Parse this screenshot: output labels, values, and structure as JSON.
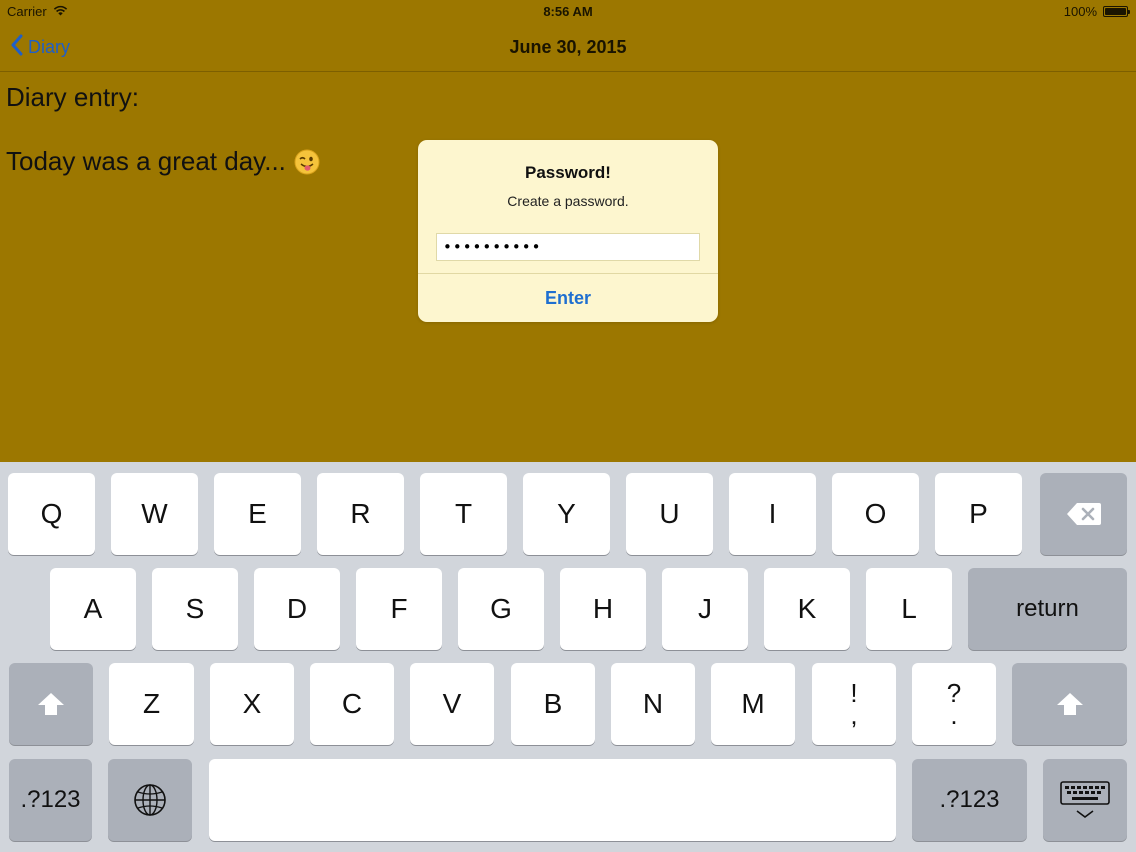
{
  "status_bar": {
    "carrier": "Carrier",
    "time": "8:56 AM",
    "battery": "100%"
  },
  "nav": {
    "back_label": "Diary",
    "title": "June 30, 2015"
  },
  "content": {
    "label": "Diary entry:",
    "text": "Today was a great day..."
  },
  "alert": {
    "title": "Password!",
    "message": "Create a password.",
    "input_value": "••••••••••",
    "button_label": "Enter"
  },
  "keyboard": {
    "row1": [
      "Q",
      "W",
      "E",
      "R",
      "T",
      "Y",
      "U",
      "I",
      "O",
      "P"
    ],
    "row2": [
      "A",
      "S",
      "D",
      "F",
      "G",
      "H",
      "J",
      "K",
      "L"
    ],
    "row3": [
      "Z",
      "X",
      "C",
      "V",
      "B",
      "N",
      "M"
    ],
    "return_label": "return",
    "numbers_label": ".?123",
    "punct1": {
      "top": "!",
      "bottom": ","
    },
    "punct2": {
      "top": "?",
      "bottom": "."
    }
  },
  "colors": {
    "background": "#9c7700",
    "accent": "#1f6fd0"
  }
}
